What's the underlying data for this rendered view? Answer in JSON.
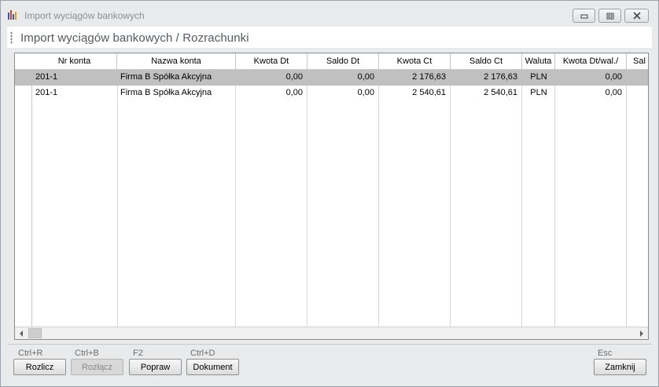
{
  "window": {
    "title": "Import wyciągów bankowych"
  },
  "header": {
    "title": "Import wyciągów bankowych / Rozrachunki"
  },
  "grid": {
    "columns": [
      "Nr konta",
      "Nazwa konta",
      "Kwota Dt",
      "Saldo Dt",
      "Kwota Ct",
      "Saldo Ct",
      "Waluta",
      "Kwota Dt/wal./",
      "Sal"
    ],
    "rows": [
      [
        "201-1",
        "Firma B Spółka Akcyjna",
        "0,00",
        "0,00",
        "2 176,63",
        "2 176,63",
        "PLN",
        "0,00"
      ],
      [
        "201-1",
        "Firma B Spółka Akcyjna",
        "0,00",
        "0,00",
        "2 540,61",
        "2 540,61",
        "PLN",
        "0,00"
      ]
    ],
    "selected_row": 0
  },
  "footer": {
    "buttons": [
      {
        "shortcut": "Ctrl+R",
        "label": "Rozlicz",
        "enabled": true
      },
      {
        "shortcut": "Ctrl+B",
        "label": "Rozłącz",
        "enabled": false
      },
      {
        "shortcut": "F2",
        "label": "Popraw",
        "enabled": true
      },
      {
        "shortcut": "Ctrl+D",
        "label": "Dokument",
        "enabled": true
      },
      {
        "shortcut": "Esc",
        "label": "Zamknij",
        "enabled": true
      }
    ]
  },
  "icons": {
    "app": "bar-chart-icon",
    "minimize": "minimize-icon",
    "maximize": "restore-icon",
    "close": "close-icon"
  }
}
